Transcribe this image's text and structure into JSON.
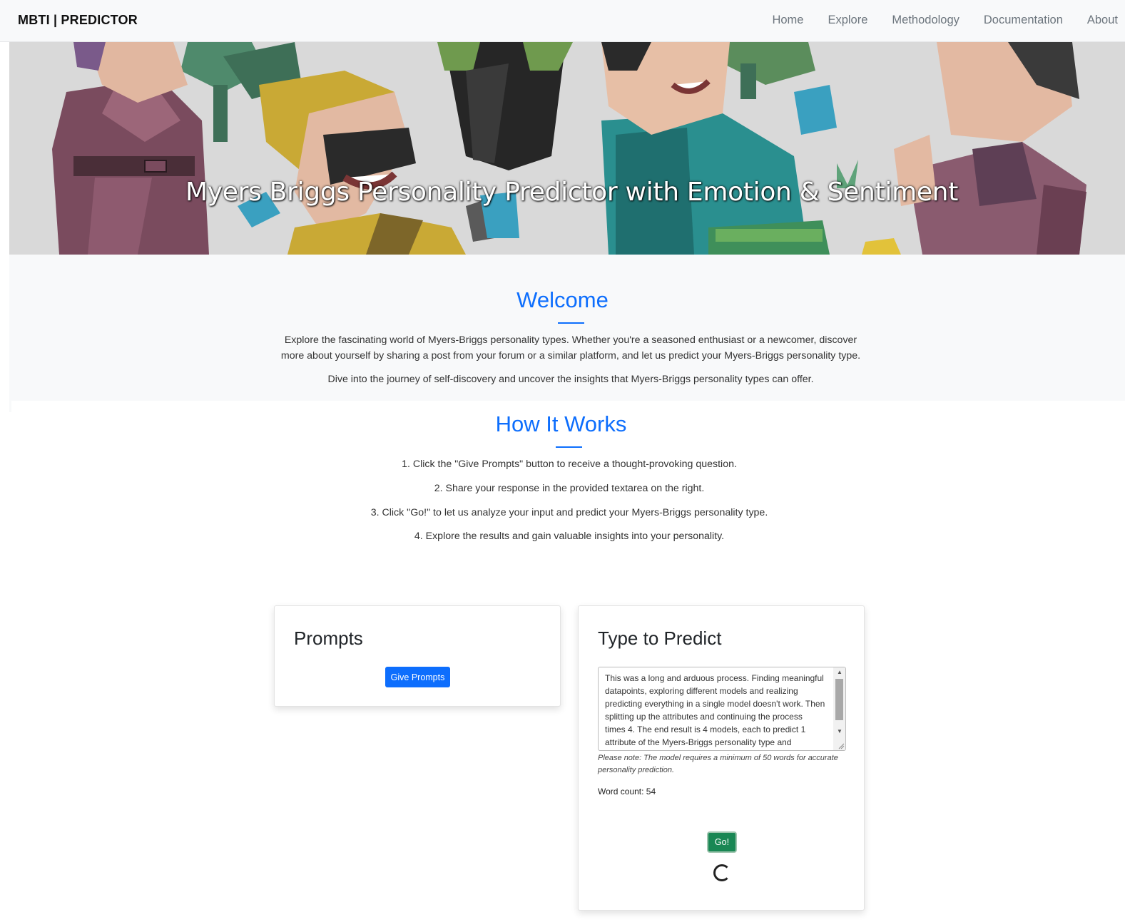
{
  "navbar": {
    "brand": "MBTI | PREDICTOR",
    "links": [
      "Home",
      "Explore",
      "Methodology",
      "Documentation",
      "About"
    ]
  },
  "hero": {
    "title": "Myers Briggs Personality Predictor with Emotion & Sentiment"
  },
  "welcome": {
    "title": "Welcome",
    "paragraph1_line1": "Explore the fascinating world of Myers-Briggs personality types. Whether you're a seasoned enthusiast or a newcomer, discover",
    "paragraph1_line2": "more about yourself by sharing a post from your forum or a similar platform, and let us predict your Myers-Briggs personality type.",
    "paragraph2": "Dive into the journey of self-discovery and uncover the insights that Myers-Briggs personality types can offer."
  },
  "how": {
    "title": "How It Works",
    "steps": [
      "1. Click the \"Give Prompts\" button to receive a thought-provoking question.",
      "2. Share your response in the provided textarea on the right.",
      "3. Click \"Go!\" to let us analyze your input and predict your Myers-Briggs personality type.",
      "4. Explore the results and gain valuable insights into your personality."
    ]
  },
  "prompts_card": {
    "title": "Prompts",
    "button_label": "Give Prompts"
  },
  "predict_card": {
    "title": "Type to Predict",
    "text_lines": [
      "This was a long and arduous process. Finding meaningful",
      "datapoints, exploring different models and realizing",
      "predicting everything in a single model doesn't work. Then",
      "splitting up the attributes and continuing the process",
      "times 4. The end result is 4 models, each to predict 1",
      "attribute of the Myers-Briggs personality type and"
    ],
    "note_line1": "Please note: The model requires a minimum of 50 words for accurate",
    "note_line2": "personality prediction.",
    "word_count": "Word count: 54",
    "go_label": "Go!"
  },
  "colors": {
    "accent": "#0d6efd",
    "go_button": "#198754",
    "navbar_bg": "#f8f9fa"
  }
}
